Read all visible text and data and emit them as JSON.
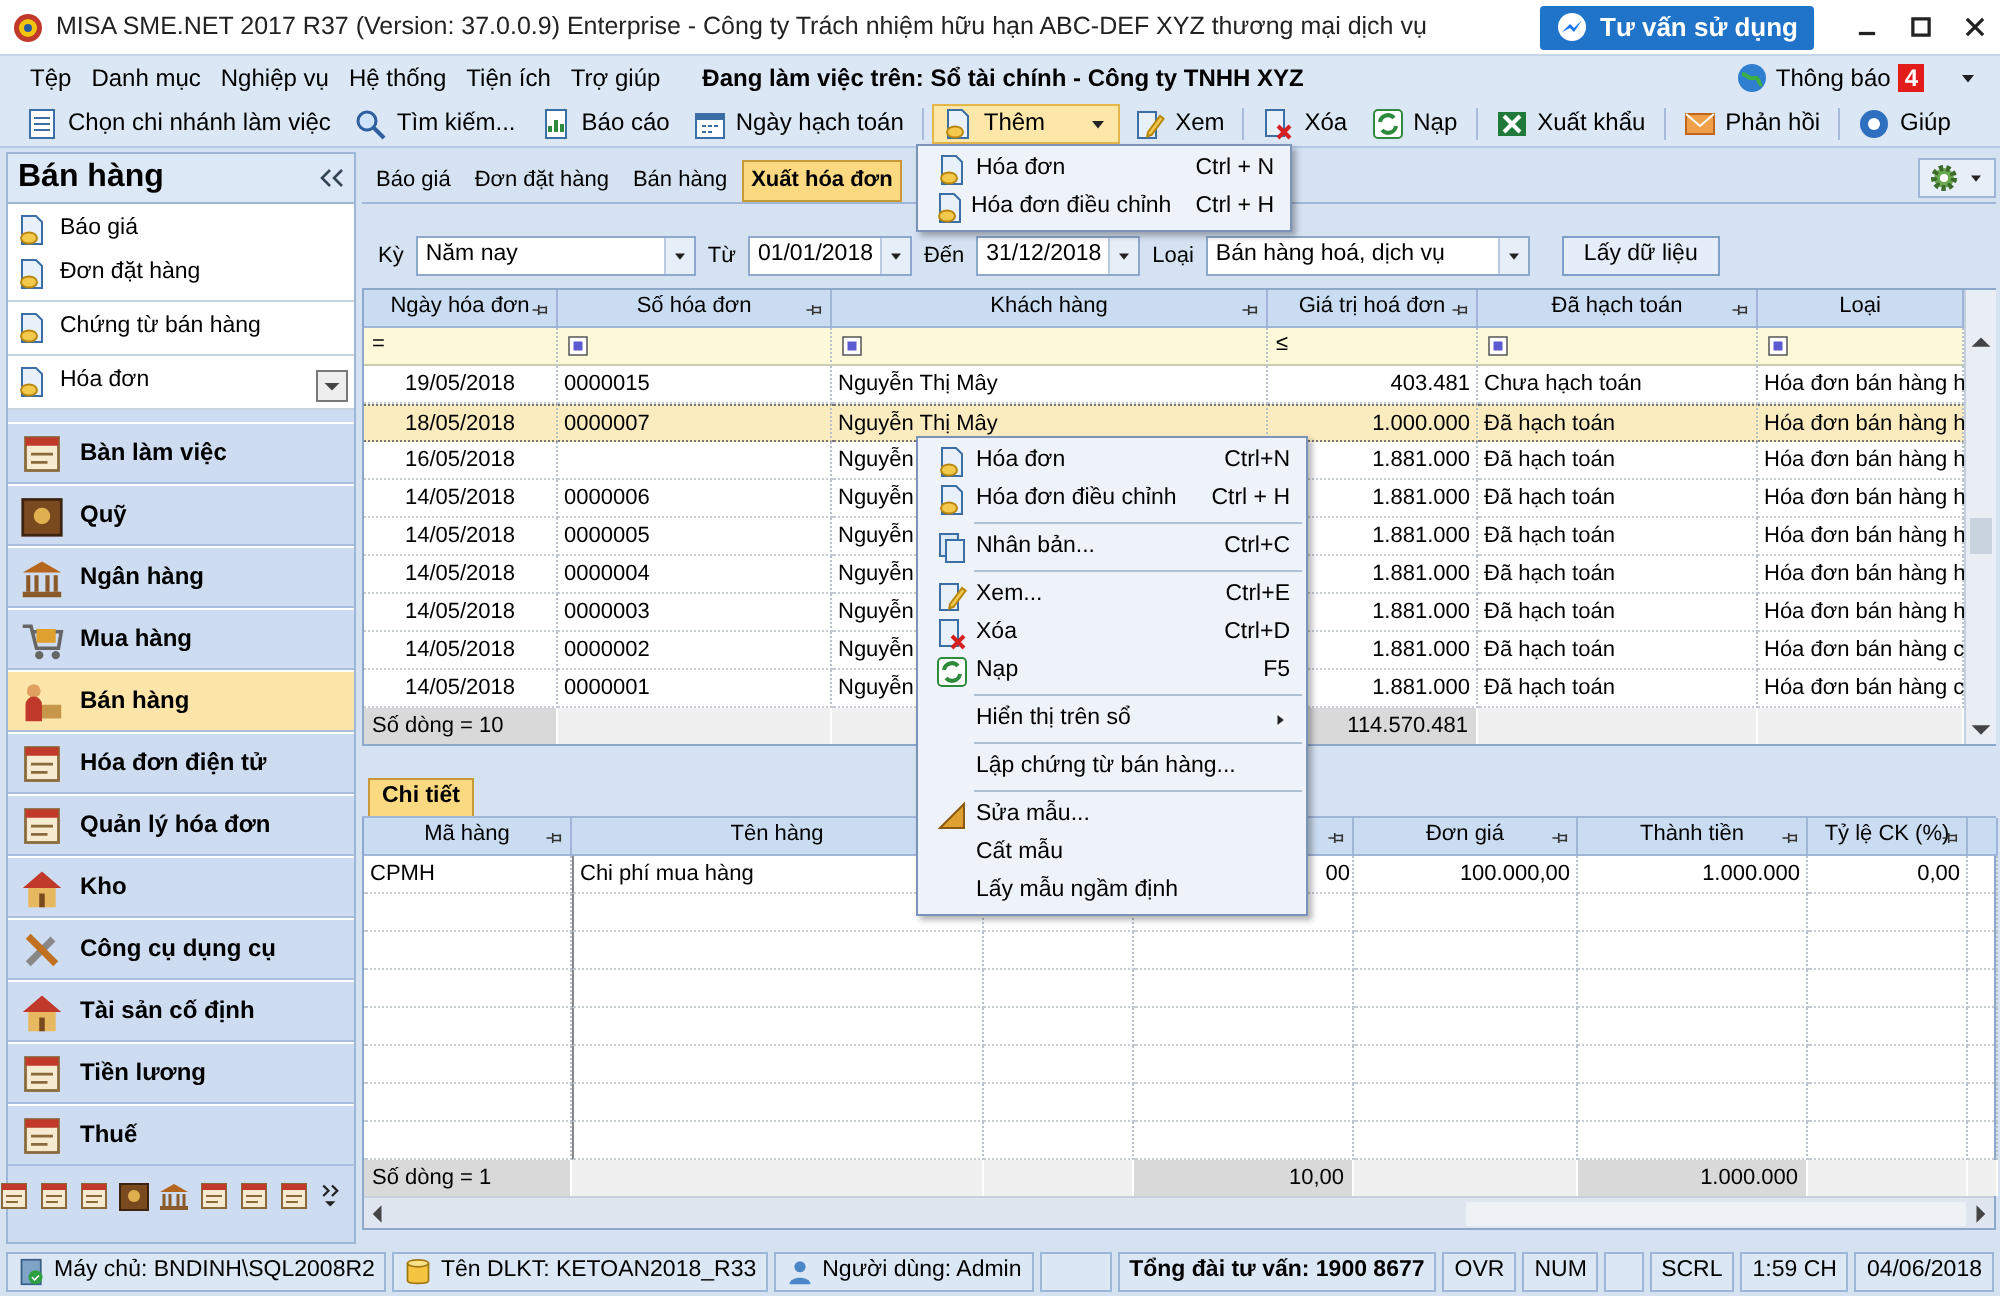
{
  "window": {
    "title": "MISA SME.NET 2017 R37 (Version: 37.0.0.9) Enterprise - Công ty Trách nhiệm hữu hạn ABC-DEF XYZ thương mại dịch vụ",
    "help_button": "Tư vấn sử dụng"
  },
  "menu_bar": {
    "items": [
      "Tệp",
      "Danh mục",
      "Nghiệp vụ",
      "Hệ thống",
      "Tiện ích",
      "Trợ giúp"
    ],
    "working_on": "Đang làm việc trên: Sổ tài chính - Công ty TNHH XYZ",
    "notifications": {
      "label": "Thông báo",
      "count": "4"
    }
  },
  "toolbar": {
    "left": [
      "Chọn chi nhánh làm việc",
      "Tìm kiếm...",
      "Báo cáo",
      "Ngày hạch toán"
    ],
    "add_button": {
      "label": "Thêm",
      "expanded": true,
      "menu": [
        {
          "label": "Hóa đơn",
          "shortcut": "Ctrl + N"
        },
        {
          "label": "Hóa đơn điều chỉnh",
          "shortcut": "Ctrl + H"
        }
      ]
    },
    "right": [
      "Xem",
      "Xóa",
      "Nạp",
      "Xuất khẩu",
      "Phản hồi",
      "Giúp"
    ]
  },
  "sidebar": {
    "title": "Bán hàng",
    "shortcut_groups": [
      [
        "Báo giá",
        "Đơn đặt hàng"
      ],
      [
        "Chứng từ bán hàng"
      ],
      [
        "Hóa đơn"
      ]
    ],
    "modules": [
      {
        "label": "Bàn làm việc",
        "selected": false
      },
      {
        "label": "Quỹ",
        "selected": false
      },
      {
        "label": "Ngân hàng",
        "selected": false
      },
      {
        "label": "Mua hàng",
        "selected": false
      },
      {
        "label": "Bán hàng",
        "selected": true
      },
      {
        "label": "Hóa đơn điện tử",
        "selected": false
      },
      {
        "label": "Quản lý hóa đơn",
        "selected": false
      },
      {
        "label": "Kho",
        "selected": false
      },
      {
        "label": "Công cụ dụng cụ",
        "selected": false
      },
      {
        "label": "Tài sản cố định",
        "selected": false
      },
      {
        "label": "Tiền lương",
        "selected": false
      },
      {
        "label": "Thuế",
        "selected": false
      }
    ]
  },
  "tabs": [
    {
      "label": "Báo giá",
      "selected": false
    },
    {
      "label": "Đơn đặt hàng",
      "selected": false
    },
    {
      "label": "Bán hàng",
      "selected": false
    },
    {
      "label": "Xuất hóa đơn",
      "selected": true
    }
  ],
  "filters": {
    "period_label": "Kỳ",
    "period": "Năm nay",
    "from_label": "Từ",
    "from": "01/01/2018",
    "to_label": "Đến",
    "to": "31/12/2018",
    "type_label": "Loại",
    "type": "Bán hàng hoá, dịch vụ",
    "fetch_button": "Lấy dữ liệu"
  },
  "invoice_table": {
    "columns": [
      "Ngày hóa đơn",
      "Số hóa đơn",
      "Khách hàng",
      "Giá trị hoá đơn",
      "Đã hạch toán",
      "Loại"
    ],
    "filter_row": [
      {
        "kind": "operator",
        "text": "="
      },
      {
        "kind": "toggle"
      },
      {
        "kind": "toggle"
      },
      {
        "kind": "operator",
        "text": "≤"
      },
      {
        "kind": "toggle"
      },
      {
        "kind": "toggle"
      }
    ],
    "rows": [
      {
        "selected": false,
        "cells": [
          "19/05/2018",
          "0000015",
          "Nguyễn Thị Mây",
          "403.481",
          "Chưa hạch toán",
          "Hóa đơn bán hàng h"
        ]
      },
      {
        "selected": true,
        "cells": [
          "18/05/2018",
          "0000007",
          "Nguyễn Thị Mây",
          "1.000.000",
          "Đã hạch toán",
          "Hóa đơn bán hàng h"
        ]
      },
      {
        "selected": false,
        "cells": [
          "16/05/2018",
          null,
          "Nguyễn",
          "1.881.000",
          "Đã hạch toán",
          "Hóa đơn bán hàng h"
        ]
      },
      {
        "selected": false,
        "cells": [
          "14/05/2018",
          "0000006",
          "Nguyễn",
          "1.881.000",
          "Đã hạch toán",
          "Hóa đơn bán hàng h"
        ]
      },
      {
        "selected": false,
        "cells": [
          "14/05/2018",
          "0000005",
          "Nguyễn",
          "1.881.000",
          "Đã hạch toán",
          "Hóa đơn bán hàng h"
        ]
      },
      {
        "selected": false,
        "cells": [
          "14/05/2018",
          "0000004",
          "Nguyễn",
          "1.881.000",
          "Đã hạch toán",
          "Hóa đơn bán hàng h"
        ]
      },
      {
        "selected": false,
        "cells": [
          "14/05/2018",
          "0000003",
          "Nguyễn",
          "1.881.000",
          "Đã hạch toán",
          "Hóa đơn bán hàng h"
        ]
      },
      {
        "selected": false,
        "cells": [
          "14/05/2018",
          "0000002",
          "Nguyễn",
          "1.881.000",
          "Đã hạch toán",
          "Hóa đơn bán hàng c"
        ]
      },
      {
        "selected": false,
        "cells": [
          "14/05/2018",
          "0000001",
          "Nguyễn",
          "1.881.000",
          "Đã hạch toán",
          "Hóa đơn bán hàng c"
        ]
      }
    ],
    "footer": [
      {
        "kind": "value",
        "text": "Số dòng = 10"
      },
      {
        "kind": "blank"
      },
      {
        "kind": "blank"
      },
      {
        "kind": "value",
        "text": "114.570.481"
      },
      {
        "kind": "blank"
      },
      {
        "kind": "blank"
      }
    ]
  },
  "context_menu": [
    {
      "kind": "item",
      "label": "Hóa đơn",
      "shortcut": "Ctrl+N"
    },
    {
      "kind": "item",
      "label": "Hóa đơn điều chỉnh",
      "shortcut": "Ctrl + H"
    },
    {
      "kind": "separator"
    },
    {
      "kind": "item",
      "label": "Nhân bản...",
      "shortcut": "Ctrl+C"
    },
    {
      "kind": "separator"
    },
    {
      "kind": "item",
      "label": "Xem...",
      "shortcut": "Ctrl+E"
    },
    {
      "kind": "item",
      "label": "Xóa",
      "shortcut": "Ctrl+D"
    },
    {
      "kind": "item",
      "label": "Nạp",
      "shortcut": "F5"
    },
    {
      "kind": "separator"
    },
    {
      "kind": "submenu",
      "label": "Hiển thị trên sổ"
    },
    {
      "kind": "separator"
    },
    {
      "kind": "item",
      "label": "Lập chứng từ bán hàng..."
    },
    {
      "kind": "separator"
    },
    {
      "kind": "item",
      "label": "Sửa mẫu..."
    },
    {
      "kind": "item",
      "label": "Cất mẫu"
    },
    {
      "kind": "item",
      "label": "Lấy mẫu ngầm định"
    }
  ],
  "detail": {
    "tab": "Chi tiết",
    "columns": [
      "Mã hàng",
      "Tên hàng",
      null,
      null,
      "Đơn giá",
      "Thành tiền",
      "Tỷ lệ CK (%)"
    ],
    "rows": [
      [
        "CPMH",
        "Chi phí mua hàng",
        null,
        "00",
        "100.000,00",
        "1.000.000",
        "0,00"
      ]
    ],
    "footer": [
      {
        "kind": "value",
        "text": "Số dòng = 1"
      },
      {
        "kind": "blank"
      },
      {
        "kind": "blank"
      },
      {
        "kind": "value",
        "text": "10,00"
      },
      {
        "kind": "blank"
      },
      {
        "kind": "value",
        "text": "1.000.000"
      },
      {
        "kind": "blank"
      }
    ]
  },
  "status_bar": [
    {
      "kind": "icon_text",
      "text": "Máy chủ: BNDINH\\SQL2008R2"
    },
    {
      "kind": "icon_text",
      "text": "Tên DLKT: KETOAN2018_R33"
    },
    {
      "kind": "icon_text",
      "text": "Người dùng: Admin"
    },
    {
      "kind": "blank"
    },
    {
      "kind": "strong",
      "text": "Tổng đài tư vấn: 1900 8677"
    },
    {
      "kind": "text",
      "text": "OVR"
    },
    {
      "kind": "text",
      "text": "NUM"
    },
    {
      "kind": "blank"
    },
    {
      "kind": "text",
      "text": "SCRL"
    },
    {
      "kind": "text",
      "text": "1:59 CH"
    },
    {
      "kind": "text",
      "text": "04/06/2018"
    }
  ]
}
